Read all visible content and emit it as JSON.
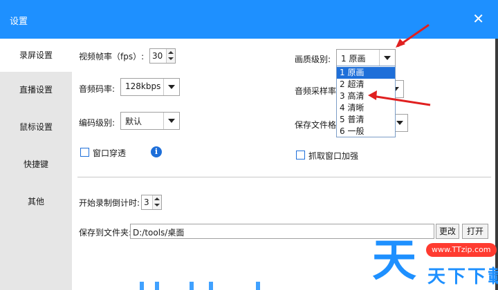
{
  "window": {
    "title": "设置",
    "close_glyph": "✕"
  },
  "sidebar": {
    "items": [
      {
        "label": "录屏设置",
        "active": true
      },
      {
        "label": "直播设置"
      },
      {
        "label": "鼠标设置"
      },
      {
        "label": "快捷键"
      },
      {
        "label": "其他"
      }
    ]
  },
  "main": {
    "fps_label": "视频帧率（fps）:",
    "fps_value": "30",
    "video_bitrate_label": "音频码率:",
    "video_bitrate_value": "128kbps",
    "encode_level_label": "编码级别:",
    "encode_level_value": "默认",
    "window_through_label": "窗口穿透",
    "info_glyph": "i",
    "quality_label": "画质级别:",
    "quality_value": "1 原画",
    "sample_rate_label": "音频采样率",
    "save_format_label": "保存文件格",
    "capture_enhance_label": "抓取窗口加强",
    "countdown_label": "开始录制倒计时:",
    "countdown_value": "3",
    "save_folder_label": "保存到文件夹:",
    "save_folder_value": "D:/tools/桌面",
    "change_button": "更改",
    "open_button": "打开"
  },
  "quality_dropdown": {
    "options": [
      "1 原画",
      "2 超清",
      "3 高清",
      "4 清晰",
      "5 普清",
      "6 一般"
    ],
    "selected_index": 0
  },
  "watermark": {
    "big_char": "天",
    "url": "www.TTzip.com",
    "text": "天下下載"
  },
  "colors": {
    "accent": "#1e90ff",
    "selection": "#1e6fd9",
    "arrow": "#e02020"
  }
}
